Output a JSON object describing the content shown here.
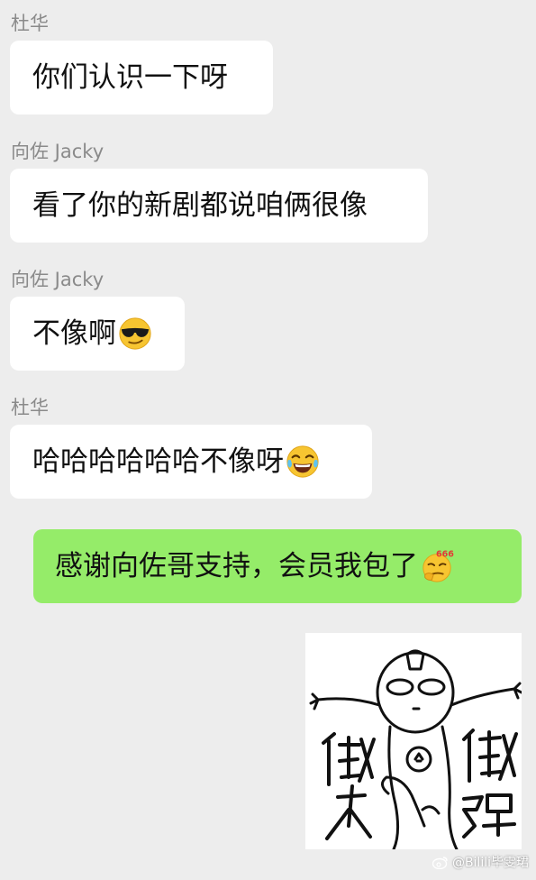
{
  "messages": [
    {
      "sender": "杜华",
      "text": "你们认识一下呀",
      "emoji": null
    },
    {
      "sender": "向佐 Jacky",
      "text": "看了你的新剧都说咱俩很像",
      "emoji": null
    },
    {
      "sender": "向佐 Jacky",
      "text": "不像啊",
      "emoji": "cool-sunglasses-emoji"
    },
    {
      "sender": "杜华",
      "text": "哈哈哈哈哈哈不像呀",
      "emoji": "tears-of-joy-emoji"
    },
    {
      "sender": null,
      "text": "感谢向佐哥支持，会员我包了",
      "emoji": "thinking-666-emoji"
    }
  ],
  "sticker": {
    "left_text": "做大",
    "right_text": "做强",
    "description_icon": "ultraman-doodle-sticker"
  },
  "watermark": {
    "icon": "weibo-icon",
    "text": "@Bilili毕雯珺"
  },
  "colors": {
    "background": "#ededed",
    "incoming_bubble": "#ffffff",
    "outgoing_bubble": "#95ec69",
    "sender_name": "#8a8a8a"
  }
}
